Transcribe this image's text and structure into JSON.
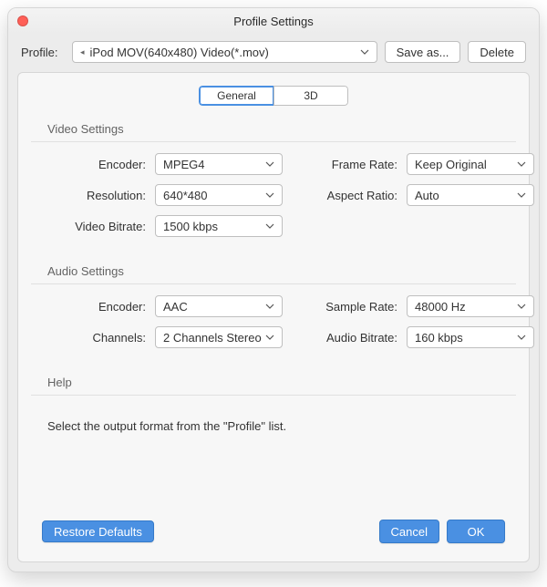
{
  "window": {
    "title": "Profile Settings"
  },
  "traffic": {
    "close_color": "#ff5f57"
  },
  "toolbar": {
    "profile_label": "Profile:",
    "profile_value": "iPod MOV(640x480) Video(*.mov)",
    "save_as_label": "Save as...",
    "delete_label": "Delete"
  },
  "tabs": {
    "general": "General",
    "three_d": "3D"
  },
  "groups": {
    "video_label": "Video Settings",
    "audio_label": "Audio Settings",
    "help_label": "Help"
  },
  "video": {
    "encoder_label": "Encoder:",
    "encoder_value": "MPEG4",
    "resolution_label": "Resolution:",
    "resolution_value": "640*480",
    "bitrate_label": "Video Bitrate:",
    "bitrate_value": "1500 kbps",
    "framerate_label": "Frame Rate:",
    "framerate_value": "Keep Original",
    "aspect_label": "Aspect Ratio:",
    "aspect_value": "Auto"
  },
  "audio": {
    "encoder_label": "Encoder:",
    "encoder_value": "AAC",
    "channels_label": "Channels:",
    "channels_value": "2 Channels Stereo",
    "samplerate_label": "Sample Rate:",
    "samplerate_value": "48000 Hz",
    "bitrate_label": "Audio Bitrate:",
    "bitrate_value": "160 kbps"
  },
  "help": {
    "text": "Select the output format from the \"Profile\" list."
  },
  "footer": {
    "restore_label": "Restore Defaults",
    "cancel_label": "Cancel",
    "ok_label": "OK"
  }
}
